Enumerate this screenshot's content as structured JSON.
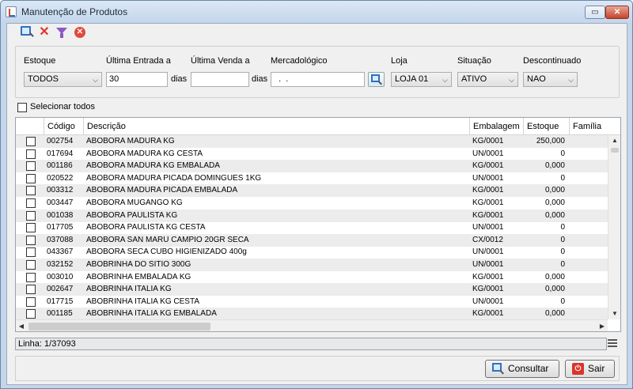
{
  "window": {
    "title": "Manutenção de Produtos",
    "maximize_glyph": "▭",
    "close_glyph": "✕"
  },
  "toolbar": {
    "icons": [
      "search-icon",
      "delete-icon",
      "filter-icon",
      "cancel-icon"
    ],
    "delete_glyph": "✕",
    "cancel_glyph": "✕"
  },
  "filters": {
    "estoque": {
      "label": "Estoque",
      "value": "TODOS"
    },
    "ultima_entrada": {
      "label": "Última Entrada a",
      "value": "30",
      "suffix": "dias"
    },
    "ultima_venda": {
      "label": "Última Venda a",
      "value": "",
      "suffix": "dias"
    },
    "mercadologico": {
      "label": "Mercadológico",
      "value": "  .  ."
    },
    "loja": {
      "label": "Loja",
      "value": "LOJA 01"
    },
    "situacao": {
      "label": "Situação",
      "value": "ATIVO"
    },
    "descontinuado": {
      "label": "Descontinuado",
      "value": "NAO"
    },
    "dropdown_glyph": "⌵"
  },
  "select_all": {
    "label": "Selecionar todos",
    "checked": false
  },
  "table": {
    "columns": [
      "",
      "Código",
      "Descrição",
      "Embalagem",
      "Estoque",
      "Família"
    ],
    "rows": [
      {
        "codigo": "002754",
        "descricao": "ABOBORA MADURA KG",
        "embalagem": "KG/0001",
        "estoque": "250,000",
        "familia": ""
      },
      {
        "codigo": "017694",
        "descricao": "ABOBORA MADURA KG CESTA",
        "embalagem": "UN/0001",
        "estoque": "0",
        "familia": ""
      },
      {
        "codigo": "001186",
        "descricao": "ABOBORA MADURA KG EMBALADA",
        "embalagem": "KG/0001",
        "estoque": "0,000",
        "familia": ""
      },
      {
        "codigo": "020522",
        "descricao": "ABOBORA MADURA PICADA DOMINGUES 1KG",
        "embalagem": "UN/0001",
        "estoque": "0",
        "familia": ""
      },
      {
        "codigo": "003312",
        "descricao": "ABOBORA MADURA PICADA EMBALADA",
        "embalagem": "KG/0001",
        "estoque": "0,000",
        "familia": ""
      },
      {
        "codigo": "003447",
        "descricao": "ABOBORA MUGANGO KG",
        "embalagem": "KG/0001",
        "estoque": "0,000",
        "familia": ""
      },
      {
        "codigo": "001038",
        "descricao": "ABOBORA PAULISTA KG",
        "embalagem": "KG/0001",
        "estoque": "0,000",
        "familia": ""
      },
      {
        "codigo": "017705",
        "descricao": "ABOBORA PAULISTA KG CESTA",
        "embalagem": "UN/0001",
        "estoque": "0",
        "familia": ""
      },
      {
        "codigo": "037088",
        "descricao": "ABOBORA SAN MARU CAMPIO 20GR SECA",
        "embalagem": "CX/0012",
        "estoque": "0",
        "familia": ""
      },
      {
        "codigo": "043367",
        "descricao": "ABOBORA SECA CUBO HIGIENIZADO 400g",
        "embalagem": "UN/0001",
        "estoque": "0",
        "familia": ""
      },
      {
        "codigo": "032152",
        "descricao": "ABOBRINHA DO SITIO 300G",
        "embalagem": "UN/0001",
        "estoque": "0",
        "familia": ""
      },
      {
        "codigo": "003010",
        "descricao": "ABOBRINHA EMBALADA KG",
        "embalagem": "KG/0001",
        "estoque": "0,000",
        "familia": ""
      },
      {
        "codigo": "002647",
        "descricao": "ABOBRINHA ITALIA KG",
        "embalagem": "KG/0001",
        "estoque": "0,000",
        "familia": ""
      },
      {
        "codigo": "017715",
        "descricao": "ABOBRINHA ITALIA KG CESTA",
        "embalagem": "UN/0001",
        "estoque": "0",
        "familia": ""
      },
      {
        "codigo": "001185",
        "descricao": "ABOBRINHA ITALIA KG EMBALADA",
        "embalagem": "KG/0001",
        "estoque": "0,000",
        "familia": ""
      }
    ]
  },
  "status": {
    "linha": "Linha: 1/37093"
  },
  "buttons": {
    "consultar": "Consultar",
    "sair": "Sair",
    "sair_glyph": "⏻"
  },
  "scroll_glyphs": {
    "up": "▲",
    "down": "▼",
    "left": "◀",
    "right": "▶"
  }
}
